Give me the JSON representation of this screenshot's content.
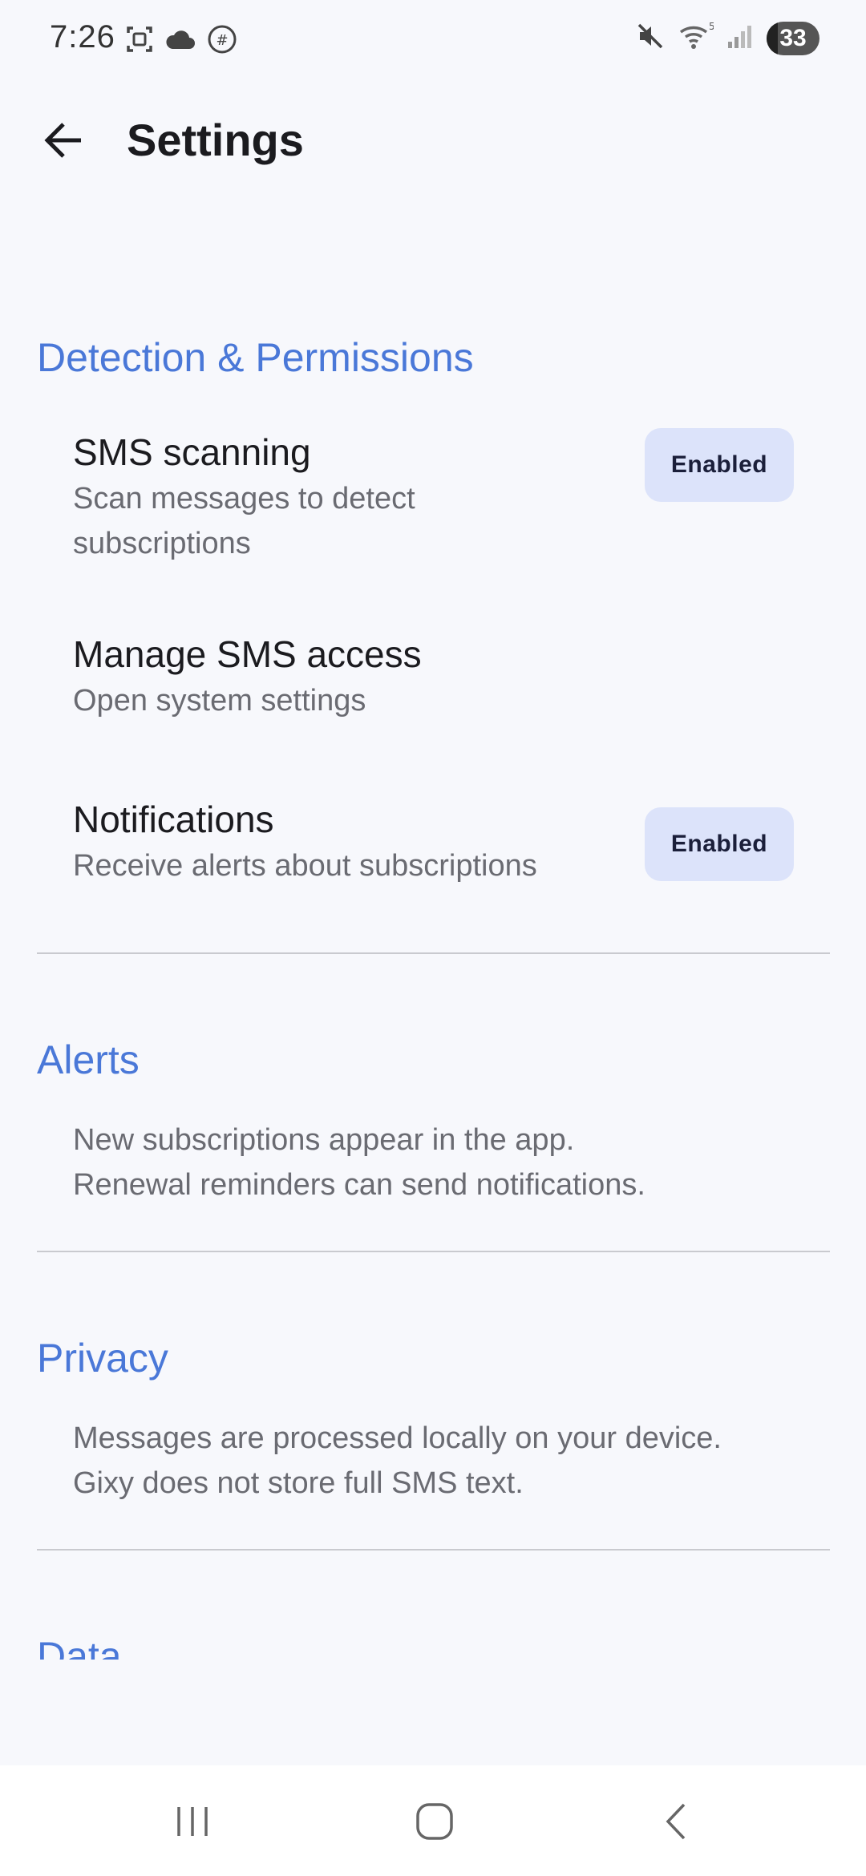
{
  "status_bar": {
    "time": "7:26",
    "battery": "33",
    "icons_left": [
      "screenshot-icon",
      "cloud-icon",
      "vpn-globe-icon"
    ],
    "icons_right": [
      "mute-icon",
      "wifi-icon",
      "signal-icon",
      "battery-icon"
    ]
  },
  "app_bar": {
    "title": "Settings",
    "back_icon": "arrow-back-icon"
  },
  "sections": {
    "detection": {
      "header": "Detection & Permissions",
      "items": [
        {
          "title": "SMS scanning",
          "subtitle": "Scan messages to detect subscriptions",
          "chip": "Enabled"
        },
        {
          "title": "Manage SMS access",
          "subtitle": "Open system settings"
        },
        {
          "title": "Notifications",
          "subtitle": "Receive alerts about subscriptions",
          "chip": "Enabled"
        }
      ]
    },
    "alerts": {
      "header": "Alerts",
      "lines": [
        "New subscriptions appear in the app.",
        "Renewal reminders can send notifications."
      ]
    },
    "privacy": {
      "header": "Privacy",
      "lines": [
        "Messages are processed locally on your device.",
        "Gixy does not store full SMS text."
      ]
    },
    "data": {
      "header": "Data"
    }
  },
  "colors": {
    "accent": "#4a78d8",
    "chip_bg": "#dce3fa",
    "background": "#f7f8fc"
  },
  "nav_bar": {
    "icons": [
      "recents-icon",
      "home-icon",
      "back-icon"
    ]
  }
}
